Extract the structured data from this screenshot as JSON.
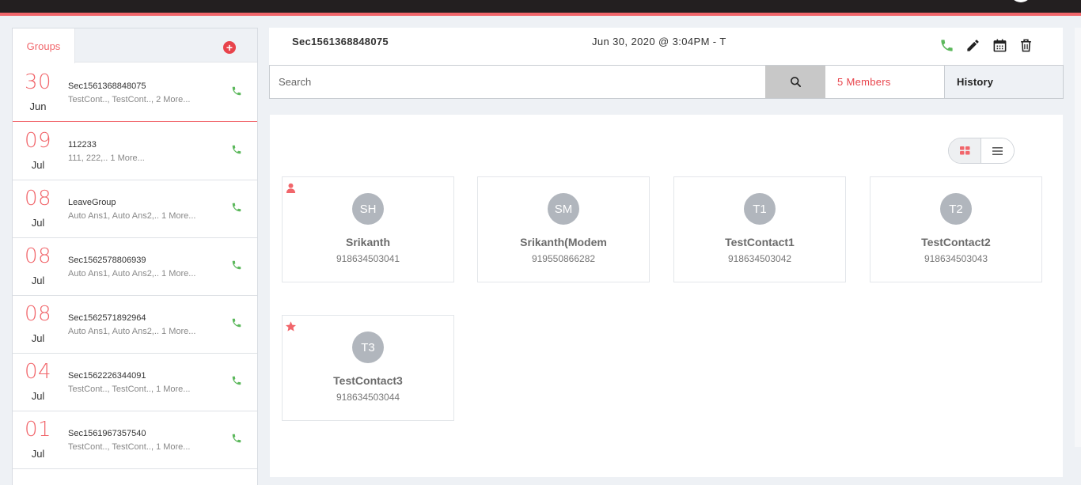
{
  "sidebar": {
    "tab_label": "Groups",
    "add_icon": "plus-circle-icon",
    "groups": [
      {
        "day": "30",
        "month": "Jun",
        "name": "Sec1561368848075",
        "members": "TestCont.., TestCont..,  2 More...",
        "active": true
      },
      {
        "day": "09",
        "month": "Jul",
        "name": "112233",
        "members": "111, 222,..  1 More...",
        "active": false
      },
      {
        "day": "08",
        "month": "Jul",
        "name": "LeaveGroup",
        "members": "Auto Ans1, Auto Ans2,..  1 More...",
        "active": false
      },
      {
        "day": "08",
        "month": "Jul",
        "name": "Sec1562578806939",
        "members": "Auto Ans1, Auto Ans2,..  1 More...",
        "active": false
      },
      {
        "day": "08",
        "month": "Jul",
        "name": "Sec1562571892964",
        "members": "Auto Ans1, Auto Ans2,..  1 More...",
        "active": false
      },
      {
        "day": "04",
        "month": "Jul",
        "name": "Sec1562226344091",
        "members": "TestCont.., TestCont..,  1 More...",
        "active": false
      },
      {
        "day": "01",
        "month": "Jul",
        "name": "Sec1561967357540",
        "members": "TestCont.., TestCont..,  1 More...",
        "active": false
      }
    ]
  },
  "header": {
    "group_title": "Sec1561368848075",
    "datetime": "Jun 30, 2020 @ 3:04PM - T",
    "icons": [
      "phone-icon",
      "pencil-icon",
      "calendar-icon",
      "trash-icon"
    ]
  },
  "search": {
    "placeholder": "Search",
    "value": ""
  },
  "tabs": {
    "members": "5 Members",
    "history": "History"
  },
  "view": {
    "mode": "grid",
    "grid_icon": "grid-icon",
    "list_icon": "list-icon"
  },
  "members": [
    {
      "initials": "SH",
      "name": "Srikanth",
      "phone": "918634503041",
      "badge": "person-icon"
    },
    {
      "initials": "SM",
      "name": "Srikanth(Modem",
      "phone": "919550866282",
      "badge": ""
    },
    {
      "initials": "T1",
      "name": "TestContact1",
      "phone": "918634503042",
      "badge": ""
    },
    {
      "initials": "T2",
      "name": "TestContact2",
      "phone": "918634503043",
      "badge": ""
    },
    {
      "initials": "T3",
      "name": "TestContact3",
      "phone": "918634503044",
      "badge": "star-icon"
    }
  ],
  "colors": {
    "accent": "#f1666b",
    "topbar": "#231f20",
    "call_green": "#5cb85c",
    "avatar_grey": "#b1b6bd"
  }
}
